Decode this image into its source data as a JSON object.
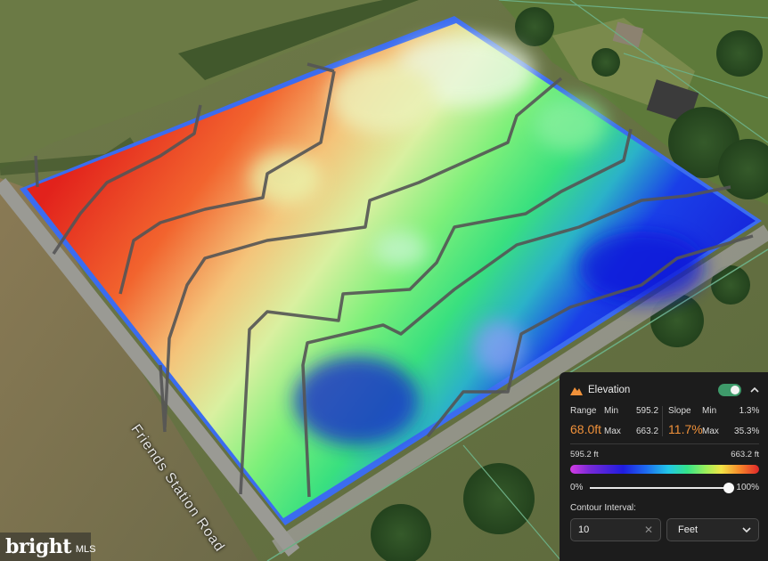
{
  "map": {
    "road_label": "Friends Station Road",
    "watermark_brand": "bright",
    "watermark_sub": "MLS"
  },
  "panel": {
    "title": "Elevation",
    "layer_enabled": true,
    "range": {
      "label": "Range",
      "value": "68.0ft",
      "min_label": "Min",
      "min": "595.2",
      "max_label": "Max",
      "max": "663.2"
    },
    "slope": {
      "label": "Slope",
      "value": "11.7%",
      "min_label": "Min",
      "min": "1.3%",
      "max_label": "Max",
      "max": "35.3%"
    },
    "scale": {
      "low": "595.2 ft",
      "high": "663.2 ft"
    },
    "opacity": {
      "min_label": "0%",
      "max_label": "100%",
      "value": 1.0
    },
    "contour": {
      "label": "Contour Interval:",
      "value": "10",
      "unit": "Feet"
    }
  },
  "colors": {
    "accent_orange": "#f0913a",
    "toggle_on": "#3e9a6a",
    "panel_bg": "#1c1c1c"
  },
  "icons": [
    "mountain-icon",
    "chevron-up-icon",
    "clear-icon",
    "chevron-down-icon"
  ]
}
